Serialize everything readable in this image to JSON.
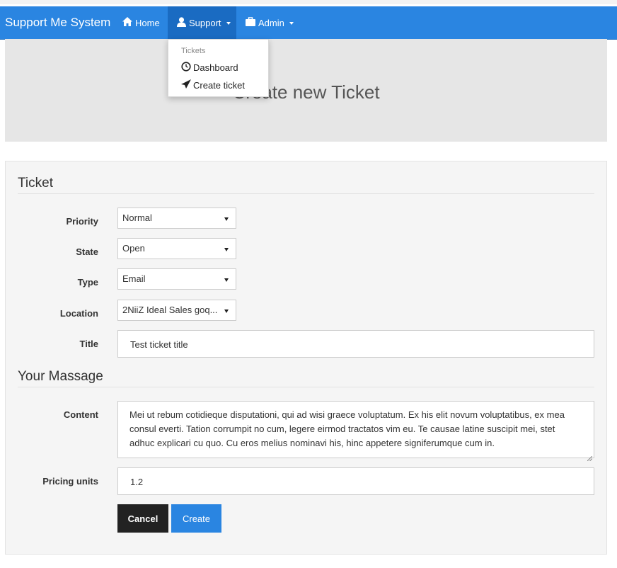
{
  "navbar": {
    "brand": "Support Me System",
    "home_label": "Home",
    "support_label": "Support",
    "admin_label": "Admin",
    "accent": "#2a85e1"
  },
  "dropdown": {
    "header": "Tickets",
    "items": [
      "Dashboard",
      "Create ticket"
    ]
  },
  "jumbotron": {
    "title": "Create new Ticket"
  },
  "form": {
    "section_ticket": "Ticket",
    "priority": {
      "label": "Priority",
      "value": "Normal"
    },
    "state": {
      "label": "State",
      "value": "Open"
    },
    "type": {
      "label": "Type",
      "value": "Email"
    },
    "location": {
      "label": "Location",
      "value": "2NiiZ Ideal Sales goq..."
    },
    "title": {
      "label": "Title",
      "value": "Test ticket title"
    },
    "section_message": "Your Massage",
    "content": {
      "label": "Content",
      "value": "Mei ut rebum cotidieque disputationi, qui ad wisi graece voluptatum. Ex his elit novum voluptatibus, ex mea consul everti. Tation corrumpit no cum, legere eirmod tractatos vim eu. Te causae latine suscipit mei, stet adhuc explicari cu quo. Cu eros melius nominavi his, hinc appetere signiferumque cum in."
    },
    "pricing": {
      "label": "Pricing units",
      "value": "1.2"
    },
    "cancel_label": "Cancel",
    "create_label": "Create"
  }
}
